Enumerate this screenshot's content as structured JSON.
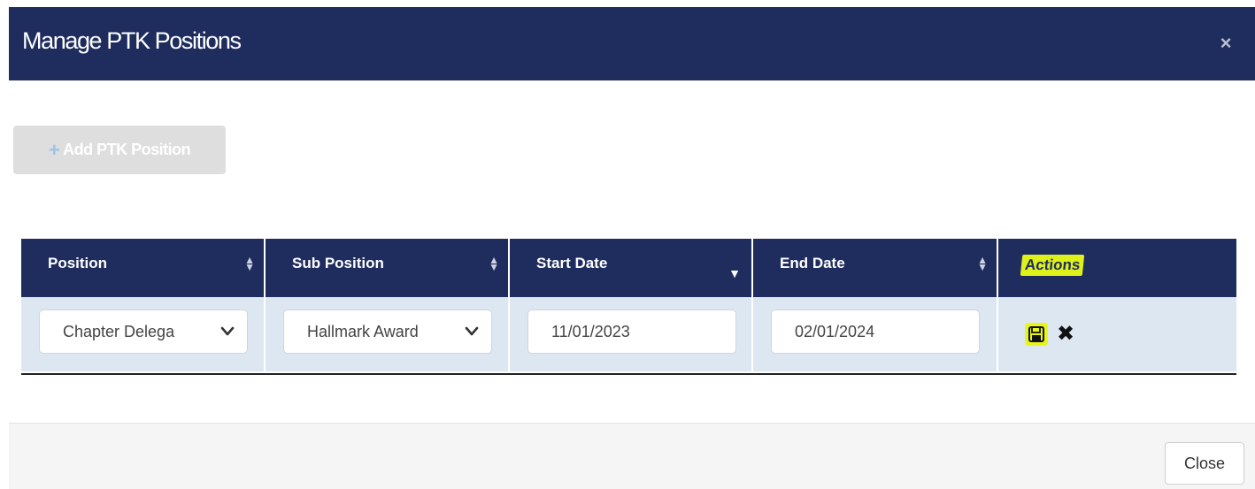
{
  "modal": {
    "title": "Manage PTK Positions",
    "close_icon": "×"
  },
  "toolbar": {
    "add_label": "Add PTK Position",
    "add_icon": "+"
  },
  "table": {
    "columns": [
      "Position",
      "Sub Position",
      "Start Date",
      "End Date",
      "Actions"
    ],
    "rows": [
      {
        "position": "Chapter Delega",
        "sub_position": "Hallmark Award",
        "start_date": "11/01/2023",
        "end_date": "02/01/2024"
      }
    ],
    "icons": {
      "sort": "sort-icon",
      "sort_desc": "sort-desc-icon",
      "save": "save-icon",
      "delete": "delete-icon",
      "dropdown": "chevron-down-icon"
    }
  },
  "footer": {
    "close_label": "Close"
  },
  "colors": {
    "header": "#1f2d5e",
    "row": "#dde7f2",
    "highlight": "#e9f51a"
  }
}
